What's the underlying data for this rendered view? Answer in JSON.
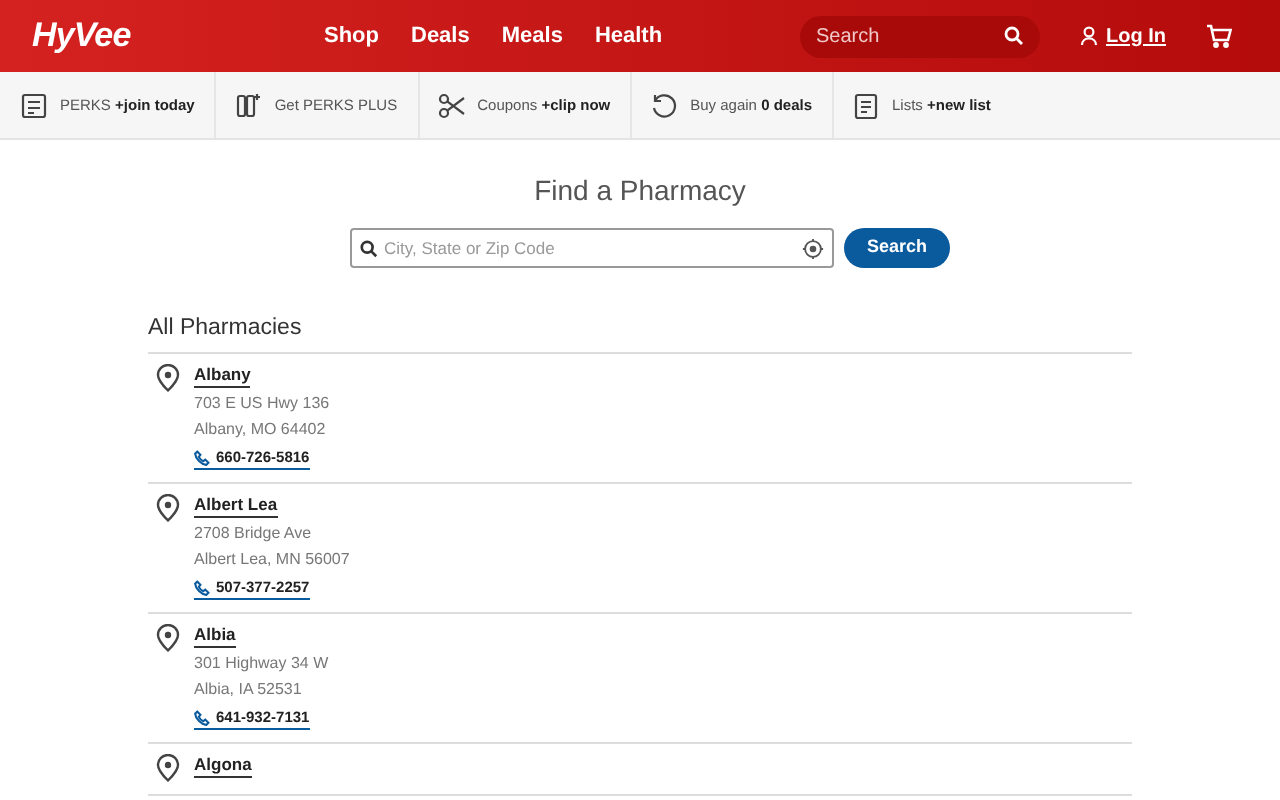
{
  "header": {
    "logo": "HyVee",
    "nav": [
      "Shop",
      "Deals",
      "Meals",
      "Health"
    ],
    "search": {
      "placeholder": "Search"
    },
    "login": "Log In"
  },
  "perks_bar": [
    {
      "kind": "perks",
      "label": "PERKS",
      "action": "+join today"
    },
    {
      "kind": "plus",
      "label": "Get PERKS PLUS"
    },
    {
      "kind": "coupons",
      "label": "Coupons",
      "action": "+clip now"
    },
    {
      "kind": "buyagain",
      "label": "Buy again",
      "action": "0 deals"
    },
    {
      "kind": "lists",
      "label": "Lists",
      "action": "+new list"
    }
  ],
  "title": "Find a Pharmacy",
  "search": {
    "placeholder": "City, State or Zip Code",
    "button": "Search"
  },
  "list_title": "All Pharmacies",
  "pharmacies": [
    {
      "name": "Albany",
      "address": "703 E US Hwy 136",
      "city": "Albany, MO 64402",
      "phone": "660-726-5816"
    },
    {
      "name": "Albert Lea",
      "address": "2708 Bridge Ave",
      "city": "Albert Lea, MN 56007",
      "phone": "507-377-2257"
    },
    {
      "name": "Albia",
      "address": "301 Highway 34 W",
      "city": "Albia, IA 52531",
      "phone": "641-932-7131"
    },
    {
      "name": "Algona"
    }
  ]
}
